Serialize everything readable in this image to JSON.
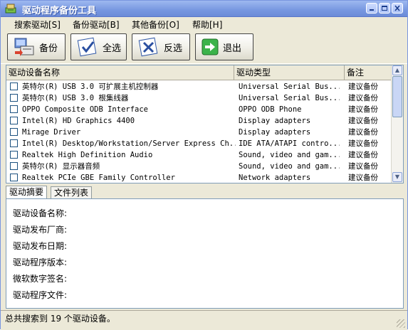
{
  "window": {
    "title": "驱动程序备份工具"
  },
  "menu": [
    {
      "label": "搜索驱动[S]"
    },
    {
      "label": "备份驱动[B]"
    },
    {
      "label": "其他备份[O]"
    },
    {
      "label": "帮助[H]"
    }
  ],
  "toolbar": {
    "backup": "备份",
    "select_all": "全选",
    "invert": "反选",
    "exit": "退出"
  },
  "table": {
    "headers": [
      "驱动设备名称",
      "驱动类型",
      "备注"
    ],
    "rows": [
      {
        "name": "英特尔(R) USB 3.0 可扩展主机控制器",
        "type": "Universal Serial Bus...",
        "note": "建议备份"
      },
      {
        "name": "英特尔(R) USB 3.0 根集线器",
        "type": "Universal Serial Bus...",
        "note": "建议备份"
      },
      {
        "name": "OPPO Composite ODB Interface",
        "type": "OPPO ODB Phone",
        "note": "建议备份"
      },
      {
        "name": "Intel(R) HD Graphics 4400",
        "type": "Display adapters",
        "note": "建议备份"
      },
      {
        "name": "Mirage Driver",
        "type": "Display adapters",
        "note": "建议备份"
      },
      {
        "name": "Intel(R) Desktop/Workstation/Server Express Ch...",
        "type": "IDE ATA/ATAPI contro...",
        "note": "建议备份"
      },
      {
        "name": "Realtek High Definition Audio",
        "type": "Sound, video and gam...",
        "note": "建议备份"
      },
      {
        "name": "英特尔(R) 显示器音频",
        "type": "Sound, video and gam...",
        "note": "建议备份"
      },
      {
        "name": "Realtek PCIe GBE Family Controller",
        "type": "Network adapters",
        "note": "建议备份"
      }
    ]
  },
  "tabs": [
    {
      "label": "驱动摘要"
    },
    {
      "label": "文件列表"
    }
  ],
  "details": [
    {
      "label": "驱动设备名称:"
    },
    {
      "label": "驱动发布厂商:"
    },
    {
      "label": "驱动发布日期:"
    },
    {
      "label": "驱动程序版本:"
    },
    {
      "label": "微软数字签名:"
    },
    {
      "label": "驱动程序文件:"
    }
  ],
  "status": {
    "text": "总共搜索到 19 个驱动设备。"
  }
}
